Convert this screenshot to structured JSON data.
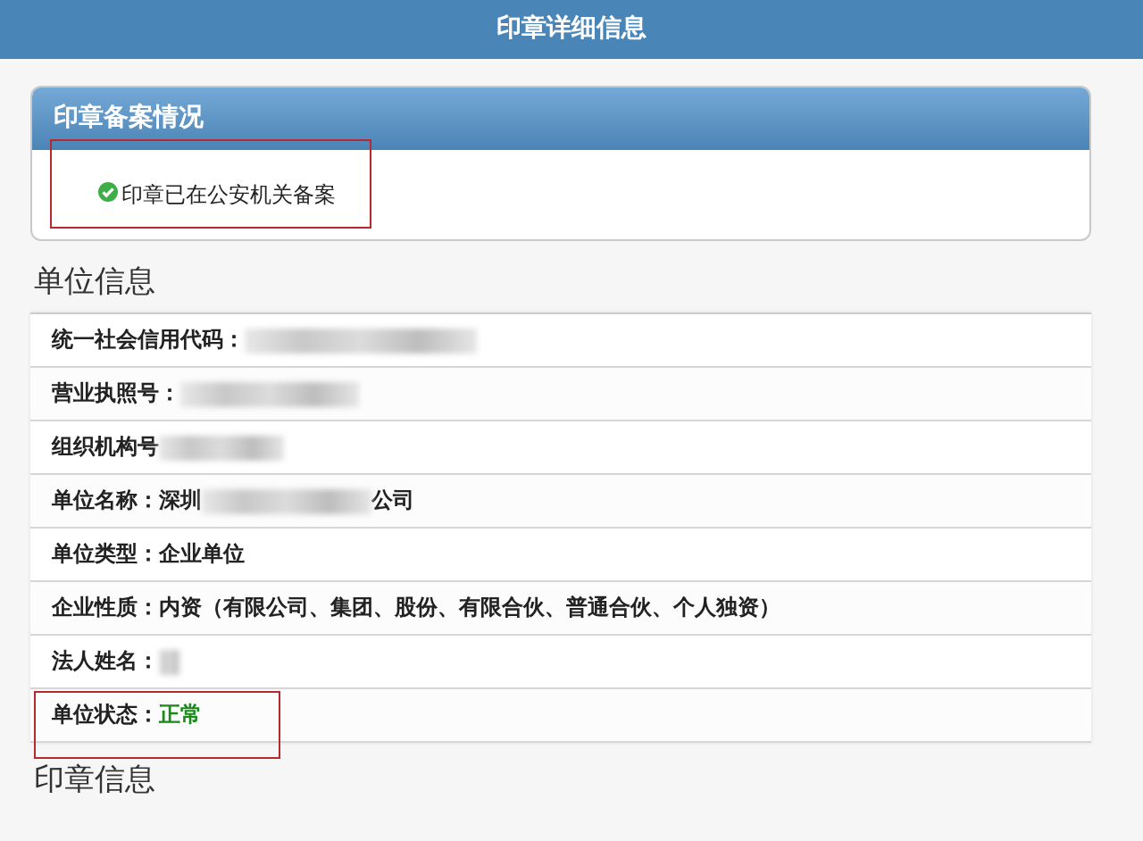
{
  "header": {
    "title": "印章详细信息"
  },
  "filing_card": {
    "title": "印章备案情况",
    "status": "印章已在公安机关备案",
    "verified": true,
    "highlighted": true
  },
  "unit_section": {
    "title": "单位信息",
    "rows": [
      {
        "label": "统一社会信用代码：",
        "value": [
          {
            "kind": "redacted"
          }
        ],
        "highlighted": false
      },
      {
        "label": "营业执照号：",
        "value": [
          {
            "kind": "redacted"
          }
        ],
        "highlighted": false
      },
      {
        "label": "组织机构号",
        "value": [
          {
            "kind": "redacted"
          }
        ],
        "highlighted": false
      },
      {
        "label": "单位名称：",
        "value": [
          {
            "kind": "text",
            "text": "深圳"
          },
          {
            "kind": "redacted"
          },
          {
            "kind": "text",
            "text": "公司"
          }
        ],
        "highlighted": false
      },
      {
        "label": "单位类型：",
        "value": [
          {
            "kind": "text",
            "text": "企业单位"
          }
        ],
        "highlighted": false
      },
      {
        "label": "企业性质：",
        "value": [
          {
            "kind": "text",
            "text": "内资（有限公司、集团、股份、有限合伙、普通合伙、个人独资）"
          }
        ],
        "highlighted": false
      },
      {
        "label": "法人姓名：",
        "value": [
          {
            "kind": "redacted"
          }
        ],
        "highlighted": false
      },
      {
        "label": "单位状态：",
        "value": [
          {
            "kind": "status",
            "text": "正常",
            "color": "#1a8a1a"
          }
        ],
        "highlighted": true
      }
    ]
  },
  "seal_section": {
    "title": "印章信息"
  }
}
